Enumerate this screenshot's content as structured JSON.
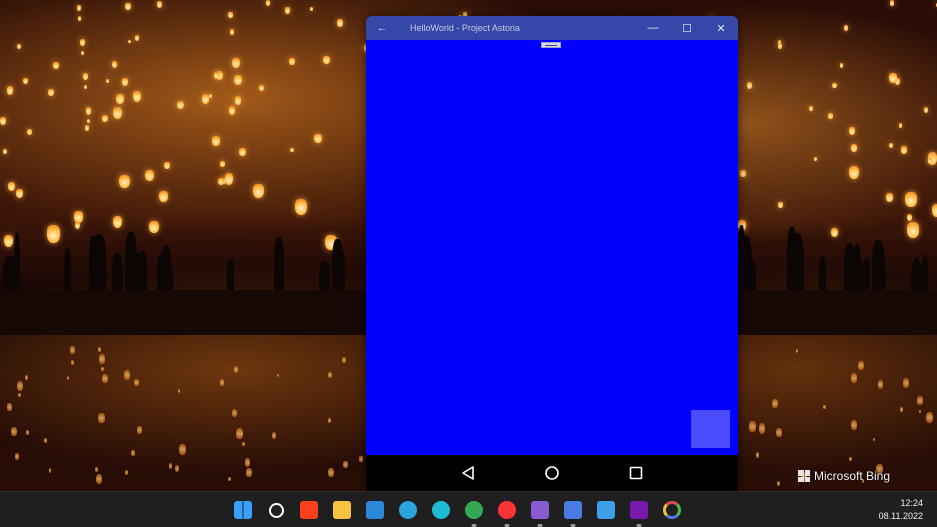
{
  "window": {
    "title": "HelloWorld - Project Astoria",
    "back_glyph": "←",
    "minimize_glyph": "—",
    "maximize_glyph": "☐",
    "close_glyph": "✕",
    "titlebar_color": "#3547a8",
    "content_color": "#0000ff",
    "square_color": "#4a4aff"
  },
  "android_nav": {
    "back_icon": "triangle-back-icon",
    "home_icon": "circle-home-icon",
    "recents_icon": "square-recents-icon"
  },
  "wallpaper": {
    "watermark": "Microsoft Bing"
  },
  "taskbar": {
    "icons": [
      {
        "name": "windows-start-icon",
        "color": "#3aa0ff",
        "running": false
      },
      {
        "name": "search-icon",
        "color": "#ffffff",
        "running": false
      },
      {
        "name": "yandex-browser-icon",
        "color": "#fc3f1d",
        "running": false
      },
      {
        "name": "file-explorer-icon",
        "color": "#f5c242",
        "running": false
      },
      {
        "name": "microsoft-store-icon",
        "color": "#2b88d8",
        "running": false
      },
      {
        "name": "telegram-icon",
        "color": "#2aa3df",
        "running": false
      },
      {
        "name": "edge-icon",
        "color": "#1ebbd7",
        "running": false
      },
      {
        "name": "chrome-icon",
        "color": "#34a853",
        "running": true
      },
      {
        "name": "yandex-icon",
        "color": "#ff3333",
        "running": true
      },
      {
        "name": "visual-studio-preview-icon",
        "color": "#8a5cd1",
        "running": true
      },
      {
        "name": "floppy-save-app-icon",
        "color": "#4a7be0",
        "running": true
      },
      {
        "name": "notepad-icon",
        "color": "#3ba0e6",
        "running": false
      },
      {
        "name": "onenote-icon",
        "color": "#7719aa",
        "running": true
      },
      {
        "name": "color-ring-app-icon",
        "color": "#e04a4a",
        "running": false
      }
    ],
    "time": "12:24",
    "date": "08.11.2022"
  }
}
